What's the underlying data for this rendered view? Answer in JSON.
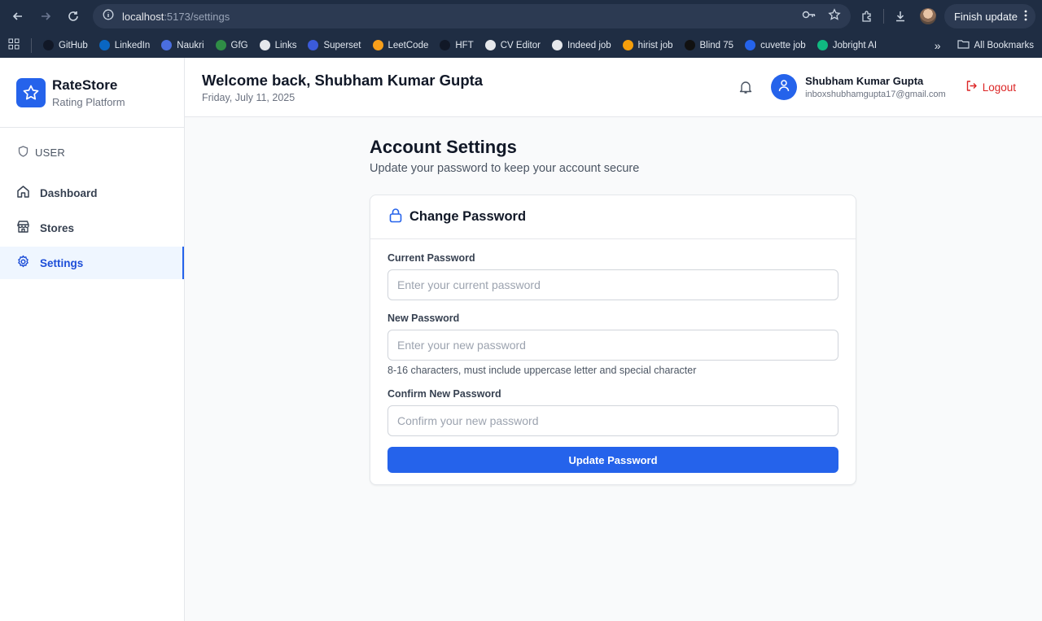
{
  "browser": {
    "url_host": "localhost",
    "url_path": ":5173/settings",
    "finish_update": "Finish update",
    "bookmarks": [
      {
        "label": "GitHub",
        "color": "#111827"
      },
      {
        "label": "LinkedIn",
        "color": "#0a66c2"
      },
      {
        "label": "Naukri",
        "color": "#4a6ee0"
      },
      {
        "label": "GfG",
        "color": "#2f8d46"
      },
      {
        "label": "Links",
        "color": "#e5e7eb"
      },
      {
        "label": "Superset",
        "color": "#3b5bdb"
      },
      {
        "label": "LeetCode",
        "color": "#f89f1b"
      },
      {
        "label": "HFT",
        "color": "#111827"
      },
      {
        "label": "CV Editor",
        "color": "#e5e7eb"
      },
      {
        "label": "Indeed job",
        "color": "#e5e7eb"
      },
      {
        "label": "hirist job",
        "color": "#f59e0b"
      },
      {
        "label": "Blind 75",
        "color": "#111111"
      },
      {
        "label": "cuvette job",
        "color": "#2563eb"
      },
      {
        "label": "Jobright AI",
        "color": "#10b981"
      }
    ],
    "overflow": "»",
    "all_bookmarks": "All Bookmarks"
  },
  "sidebar": {
    "brand_name": "RateStore",
    "brand_sub": "Rating Platform",
    "role": "USER",
    "items": [
      {
        "label": "Dashboard",
        "icon": "home-icon"
      },
      {
        "label": "Stores",
        "icon": "store-icon"
      },
      {
        "label": "Settings",
        "icon": "gear-icon",
        "active": true
      }
    ]
  },
  "header": {
    "welcome": "Welcome back, Shubham Kumar Gupta",
    "date": "Friday, July 11, 2025",
    "user_name": "Shubham Kumar Gupta",
    "user_email": "inboxshubhamgupta17@gmail.com",
    "logout": "Logout"
  },
  "page": {
    "title": "Account Settings",
    "subtitle": "Update your password to keep your account secure",
    "card_title": "Change Password",
    "current_label": "Current Password",
    "current_placeholder": "Enter your current password",
    "new_label": "New Password",
    "new_placeholder": "Enter your new password",
    "new_hint": "8-16 characters, must include uppercase letter and special character",
    "confirm_label": "Confirm New Password",
    "confirm_placeholder": "Confirm your new password",
    "submit": "Update Password"
  },
  "colors": {
    "accent": "#2563eb",
    "danger": "#dc2626",
    "chrome": "#1f2d43"
  }
}
